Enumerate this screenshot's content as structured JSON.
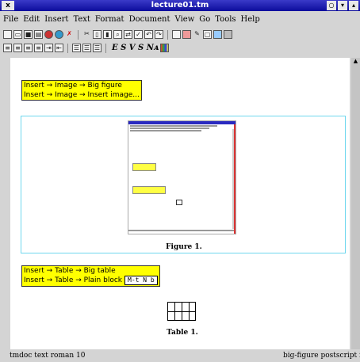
{
  "window": {
    "title": "lecture01.tm",
    "close_label": "x"
  },
  "menu": [
    "File",
    "Edit",
    "Insert",
    "Text",
    "Format",
    "Document",
    "View",
    "Go",
    "Tools",
    "Help"
  ],
  "toolbar1_icons": [
    "new-icon",
    "open-icon",
    "save-icon",
    "print-icon",
    "globe-icon",
    "globe-icon",
    "close-icon",
    "cut-icon",
    "copy-icon",
    "paste-icon",
    "search-icon",
    "replace-icon",
    "spell-icon",
    "undo-icon",
    "redo-icon",
    "rectangle-icon",
    "image-icon",
    "pen-icon",
    "screen-icon",
    "settings-icon",
    "table-icon"
  ],
  "toolbar2_icons": [
    "align-left-icon",
    "align-center-icon",
    "align-right-icon",
    "justify-icon",
    "indent-icon",
    "outdent-icon",
    "bullet-list-icon",
    "numbered-list-icon",
    "description-list-icon"
  ],
  "toolbar2_text": "E S V S Nᴀ",
  "doc": {
    "image_box": {
      "line1": "Insert → Image → Big figure",
      "line2": "Insert → Image → Insert image..."
    },
    "figure_caption": "Figure 1.",
    "table_box": {
      "line1": "Insert → Table → Big table",
      "line2": "Insert → Table → Plain block",
      "shortcut": "M-t N b"
    },
    "table_caption": "Table 1."
  },
  "status": {
    "left": "tmdoc text roman 10",
    "right": "big-figure postscript imag"
  },
  "colors": {
    "titlebar": "#0c0c9c",
    "highlight": "#ffff00",
    "figure_border": "#6fd7ee"
  }
}
